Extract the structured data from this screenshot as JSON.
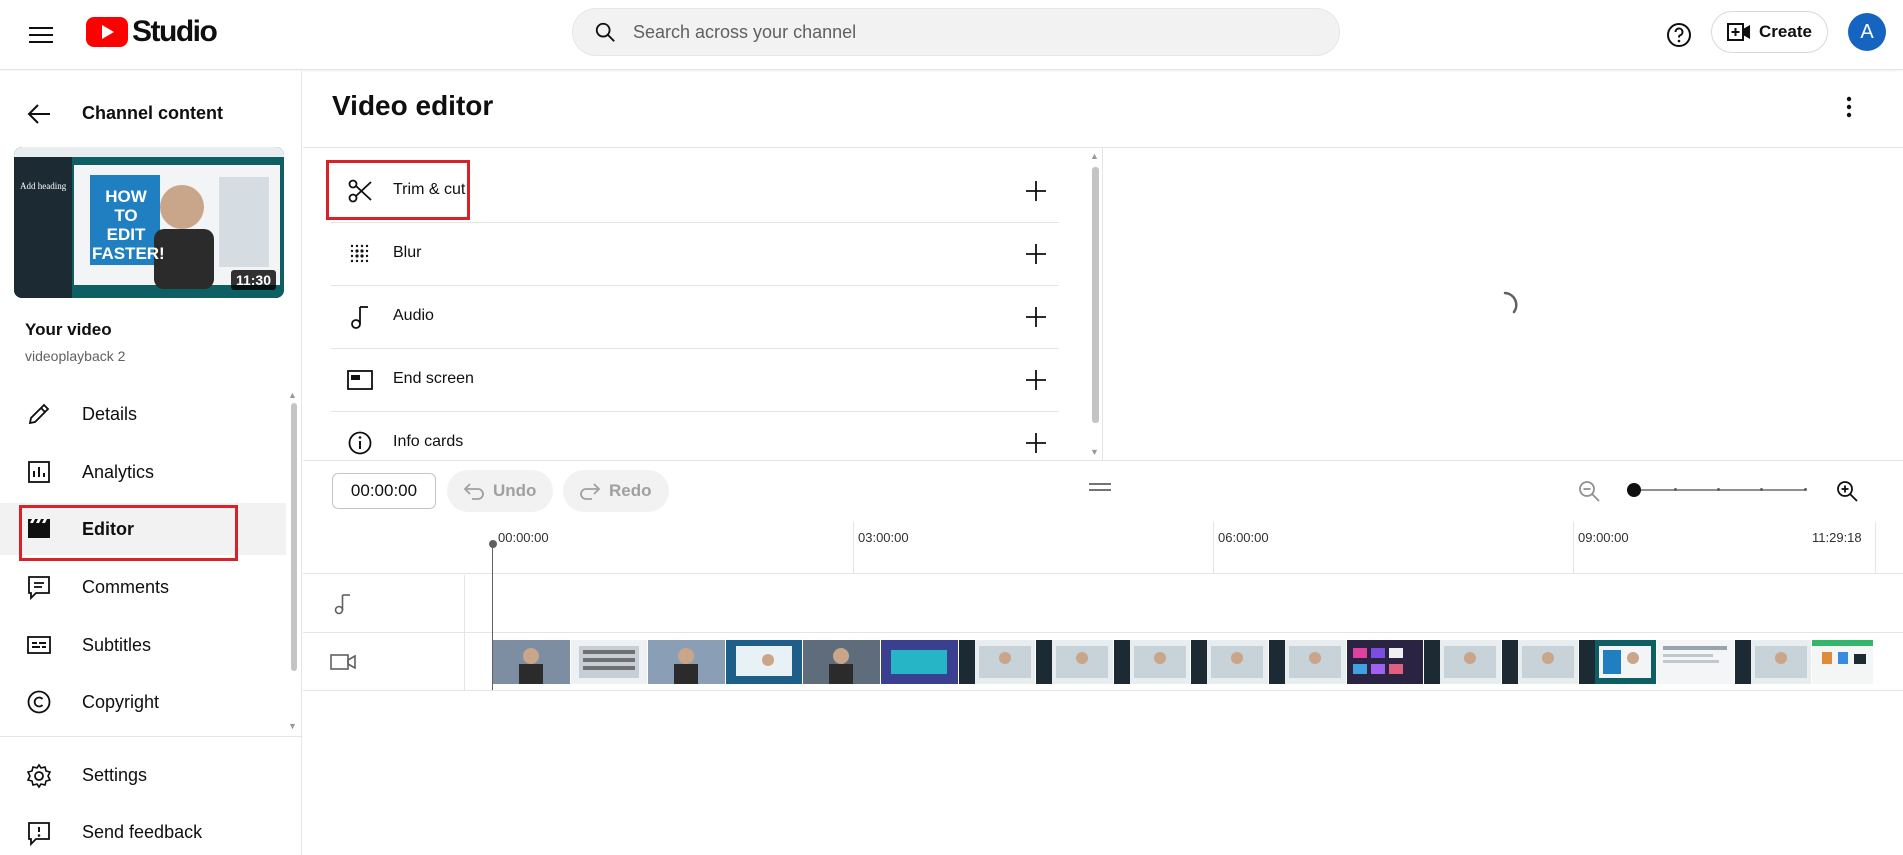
{
  "header": {
    "logo_text": "Studio",
    "search_placeholder": "Search across your channel",
    "create_label": "Create",
    "avatar_letter": "A",
    "brand_red": "#ff0000",
    "avatar_color": "#1565c0"
  },
  "sidebar": {
    "back_label": "Channel content",
    "thumbnail": {
      "duration": "11:30",
      "overlay_lines": [
        "Add heading",
        "HOW TO",
        "EDIT",
        "FASTER!"
      ]
    },
    "your_video_label": "Your video",
    "video_name": "videoplayback 2",
    "items": [
      {
        "label": "Details",
        "icon": "pencil-icon"
      },
      {
        "label": "Analytics",
        "icon": "analytics-icon"
      },
      {
        "label": "Editor",
        "icon": "clapperboard-icon",
        "active": true
      },
      {
        "label": "Comments",
        "icon": "comment-icon"
      },
      {
        "label": "Subtitles",
        "icon": "subtitles-icon"
      },
      {
        "label": "Copyright",
        "icon": "copyright-icon"
      }
    ],
    "bottom_items": [
      {
        "label": "Settings",
        "icon": "gear-icon"
      },
      {
        "label": "Send feedback",
        "icon": "feedback-icon"
      }
    ]
  },
  "main": {
    "title": "Video editor",
    "tools": [
      {
        "label": "Trim & cut",
        "icon": "scissors-icon"
      },
      {
        "label": "Blur",
        "icon": "blur-icon"
      },
      {
        "label": "Audio",
        "icon": "music-note-icon"
      },
      {
        "label": "End screen",
        "icon": "end-screen-icon"
      },
      {
        "label": "Info cards",
        "icon": "info-icon"
      }
    ],
    "timeline": {
      "current_time": "00:00:00",
      "undo_label": "Undo",
      "redo_label": "Redo",
      "ticks": [
        "00:00:00",
        "03:00:00",
        "06:00:00",
        "09:00:00",
        "11:29:18"
      ],
      "zoom_level": 0
    }
  },
  "highlight_color": "#d92128"
}
